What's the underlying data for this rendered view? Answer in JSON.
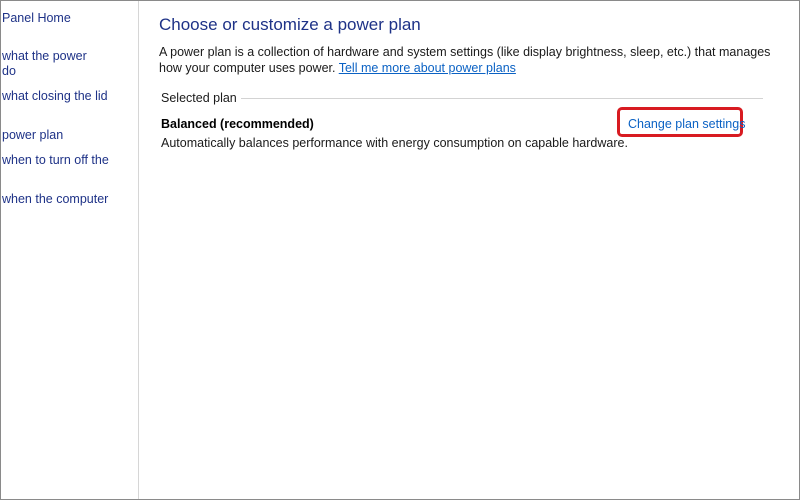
{
  "sidebar": {
    "items": [
      {
        "label": "Panel Home"
      },
      {
        "label": "what the power"
      },
      {
        "label": "do"
      },
      {
        "label": "what closing the lid"
      },
      {
        "label": "power plan"
      },
      {
        "label": "when to turn off the"
      },
      {
        "label": "when the computer"
      }
    ]
  },
  "main": {
    "title": "Choose or customize a power plan",
    "description_line1": "A power plan is a collection of hardware and system settings (like display brightness, sleep, etc.) that manages",
    "description_line2": "how your computer uses power.",
    "learn_more_link": "Tell me more about power plans",
    "selected_plan_header": "Selected plan",
    "plan": {
      "name": "Balanced (recommended)",
      "description": "Automatically balances performance with energy consumption on capable hardware.",
      "change_link": "Change plan settings"
    }
  },
  "colors": {
    "link": "#0b62c4",
    "title": "#1e3287",
    "highlight": "#d81b21"
  }
}
